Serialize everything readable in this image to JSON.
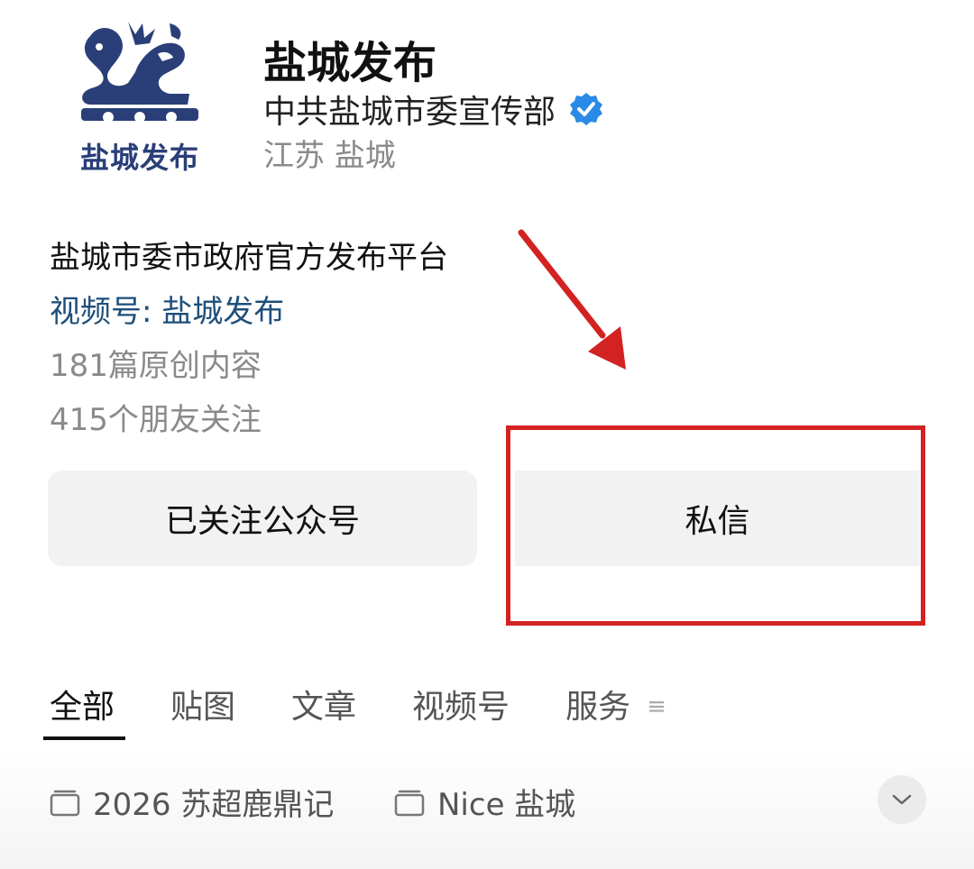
{
  "header": {
    "logo_text": "盐城发布",
    "account_name": "盐城发布",
    "owner": "中共盐城市委宣传部",
    "location": "江苏 盐城"
  },
  "profile": {
    "description": "盐城市委市政府官方发布平台",
    "channel": "视频号: 盐城发布",
    "articles": "181篇原创内容",
    "followers": "415个朋友关注"
  },
  "actions": {
    "follow_label": "已关注公众号",
    "message_label": "私信"
  },
  "tabs": [
    {
      "label": "全部",
      "active": true
    },
    {
      "label": "贴图",
      "active": false
    },
    {
      "label": "文章",
      "active": false
    },
    {
      "label": "视频号",
      "active": false
    },
    {
      "label": "服务",
      "active": false
    }
  ],
  "albums": [
    {
      "label": "2026 苏超鹿鼎记"
    },
    {
      "label": "Nice 盐城"
    }
  ],
  "colors": {
    "logo_blue": "#2a3f78",
    "verified_blue": "#2b8ae6",
    "link_blue": "#1e4f7a",
    "annotation_red": "#d32222",
    "button_bg": "#f2f2f2"
  },
  "icons": {
    "verified": "verified-badge-icon",
    "tab_menu": "menu-lines-icon",
    "album": "folder-icon",
    "expand": "chevron-down-icon"
  }
}
